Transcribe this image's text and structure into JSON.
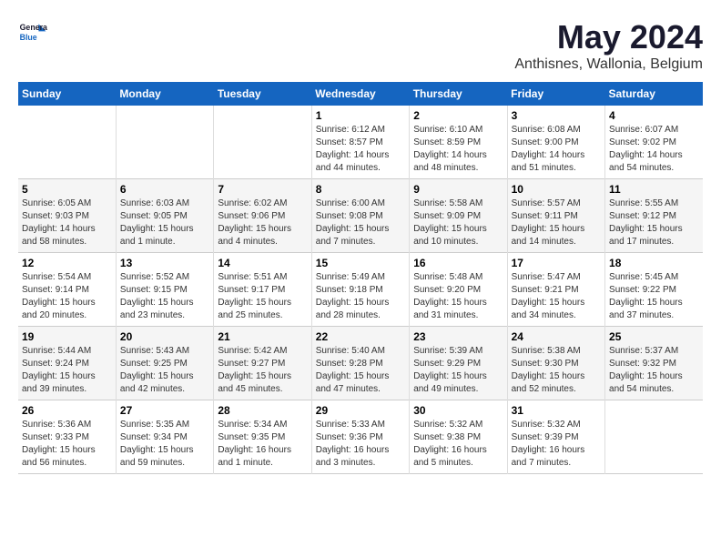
{
  "logo": {
    "line1": "General",
    "line2": "Blue"
  },
  "title": "May 2024",
  "subtitle": "Anthisnes, Wallonia, Belgium",
  "header_days": [
    "Sunday",
    "Monday",
    "Tuesday",
    "Wednesday",
    "Thursday",
    "Friday",
    "Saturday"
  ],
  "weeks": [
    [
      {
        "day": "",
        "info": ""
      },
      {
        "day": "",
        "info": ""
      },
      {
        "day": "",
        "info": ""
      },
      {
        "day": "1",
        "info": "Sunrise: 6:12 AM\nSunset: 8:57 PM\nDaylight: 14 hours\nand 44 minutes."
      },
      {
        "day": "2",
        "info": "Sunrise: 6:10 AM\nSunset: 8:59 PM\nDaylight: 14 hours\nand 48 minutes."
      },
      {
        "day": "3",
        "info": "Sunrise: 6:08 AM\nSunset: 9:00 PM\nDaylight: 14 hours\nand 51 minutes."
      },
      {
        "day": "4",
        "info": "Sunrise: 6:07 AM\nSunset: 9:02 PM\nDaylight: 14 hours\nand 54 minutes."
      }
    ],
    [
      {
        "day": "5",
        "info": "Sunrise: 6:05 AM\nSunset: 9:03 PM\nDaylight: 14 hours\nand 58 minutes."
      },
      {
        "day": "6",
        "info": "Sunrise: 6:03 AM\nSunset: 9:05 PM\nDaylight: 15 hours\nand 1 minute."
      },
      {
        "day": "7",
        "info": "Sunrise: 6:02 AM\nSunset: 9:06 PM\nDaylight: 15 hours\nand 4 minutes."
      },
      {
        "day": "8",
        "info": "Sunrise: 6:00 AM\nSunset: 9:08 PM\nDaylight: 15 hours\nand 7 minutes."
      },
      {
        "day": "9",
        "info": "Sunrise: 5:58 AM\nSunset: 9:09 PM\nDaylight: 15 hours\nand 10 minutes."
      },
      {
        "day": "10",
        "info": "Sunrise: 5:57 AM\nSunset: 9:11 PM\nDaylight: 15 hours\nand 14 minutes."
      },
      {
        "day": "11",
        "info": "Sunrise: 5:55 AM\nSunset: 9:12 PM\nDaylight: 15 hours\nand 17 minutes."
      }
    ],
    [
      {
        "day": "12",
        "info": "Sunrise: 5:54 AM\nSunset: 9:14 PM\nDaylight: 15 hours\nand 20 minutes."
      },
      {
        "day": "13",
        "info": "Sunrise: 5:52 AM\nSunset: 9:15 PM\nDaylight: 15 hours\nand 23 minutes."
      },
      {
        "day": "14",
        "info": "Sunrise: 5:51 AM\nSunset: 9:17 PM\nDaylight: 15 hours\nand 25 minutes."
      },
      {
        "day": "15",
        "info": "Sunrise: 5:49 AM\nSunset: 9:18 PM\nDaylight: 15 hours\nand 28 minutes."
      },
      {
        "day": "16",
        "info": "Sunrise: 5:48 AM\nSunset: 9:20 PM\nDaylight: 15 hours\nand 31 minutes."
      },
      {
        "day": "17",
        "info": "Sunrise: 5:47 AM\nSunset: 9:21 PM\nDaylight: 15 hours\nand 34 minutes."
      },
      {
        "day": "18",
        "info": "Sunrise: 5:45 AM\nSunset: 9:22 PM\nDaylight: 15 hours\nand 37 minutes."
      }
    ],
    [
      {
        "day": "19",
        "info": "Sunrise: 5:44 AM\nSunset: 9:24 PM\nDaylight: 15 hours\nand 39 minutes."
      },
      {
        "day": "20",
        "info": "Sunrise: 5:43 AM\nSunset: 9:25 PM\nDaylight: 15 hours\nand 42 minutes."
      },
      {
        "day": "21",
        "info": "Sunrise: 5:42 AM\nSunset: 9:27 PM\nDaylight: 15 hours\nand 45 minutes."
      },
      {
        "day": "22",
        "info": "Sunrise: 5:40 AM\nSunset: 9:28 PM\nDaylight: 15 hours\nand 47 minutes."
      },
      {
        "day": "23",
        "info": "Sunrise: 5:39 AM\nSunset: 9:29 PM\nDaylight: 15 hours\nand 49 minutes."
      },
      {
        "day": "24",
        "info": "Sunrise: 5:38 AM\nSunset: 9:30 PM\nDaylight: 15 hours\nand 52 minutes."
      },
      {
        "day": "25",
        "info": "Sunrise: 5:37 AM\nSunset: 9:32 PM\nDaylight: 15 hours\nand 54 minutes."
      }
    ],
    [
      {
        "day": "26",
        "info": "Sunrise: 5:36 AM\nSunset: 9:33 PM\nDaylight: 15 hours\nand 56 minutes."
      },
      {
        "day": "27",
        "info": "Sunrise: 5:35 AM\nSunset: 9:34 PM\nDaylight: 15 hours\nand 59 minutes."
      },
      {
        "day": "28",
        "info": "Sunrise: 5:34 AM\nSunset: 9:35 PM\nDaylight: 16 hours\nand 1 minute."
      },
      {
        "day": "29",
        "info": "Sunrise: 5:33 AM\nSunset: 9:36 PM\nDaylight: 16 hours\nand 3 minutes."
      },
      {
        "day": "30",
        "info": "Sunrise: 5:32 AM\nSunset: 9:38 PM\nDaylight: 16 hours\nand 5 minutes."
      },
      {
        "day": "31",
        "info": "Sunrise: 5:32 AM\nSunset: 9:39 PM\nDaylight: 16 hours\nand 7 minutes."
      },
      {
        "day": "",
        "info": ""
      }
    ]
  ]
}
